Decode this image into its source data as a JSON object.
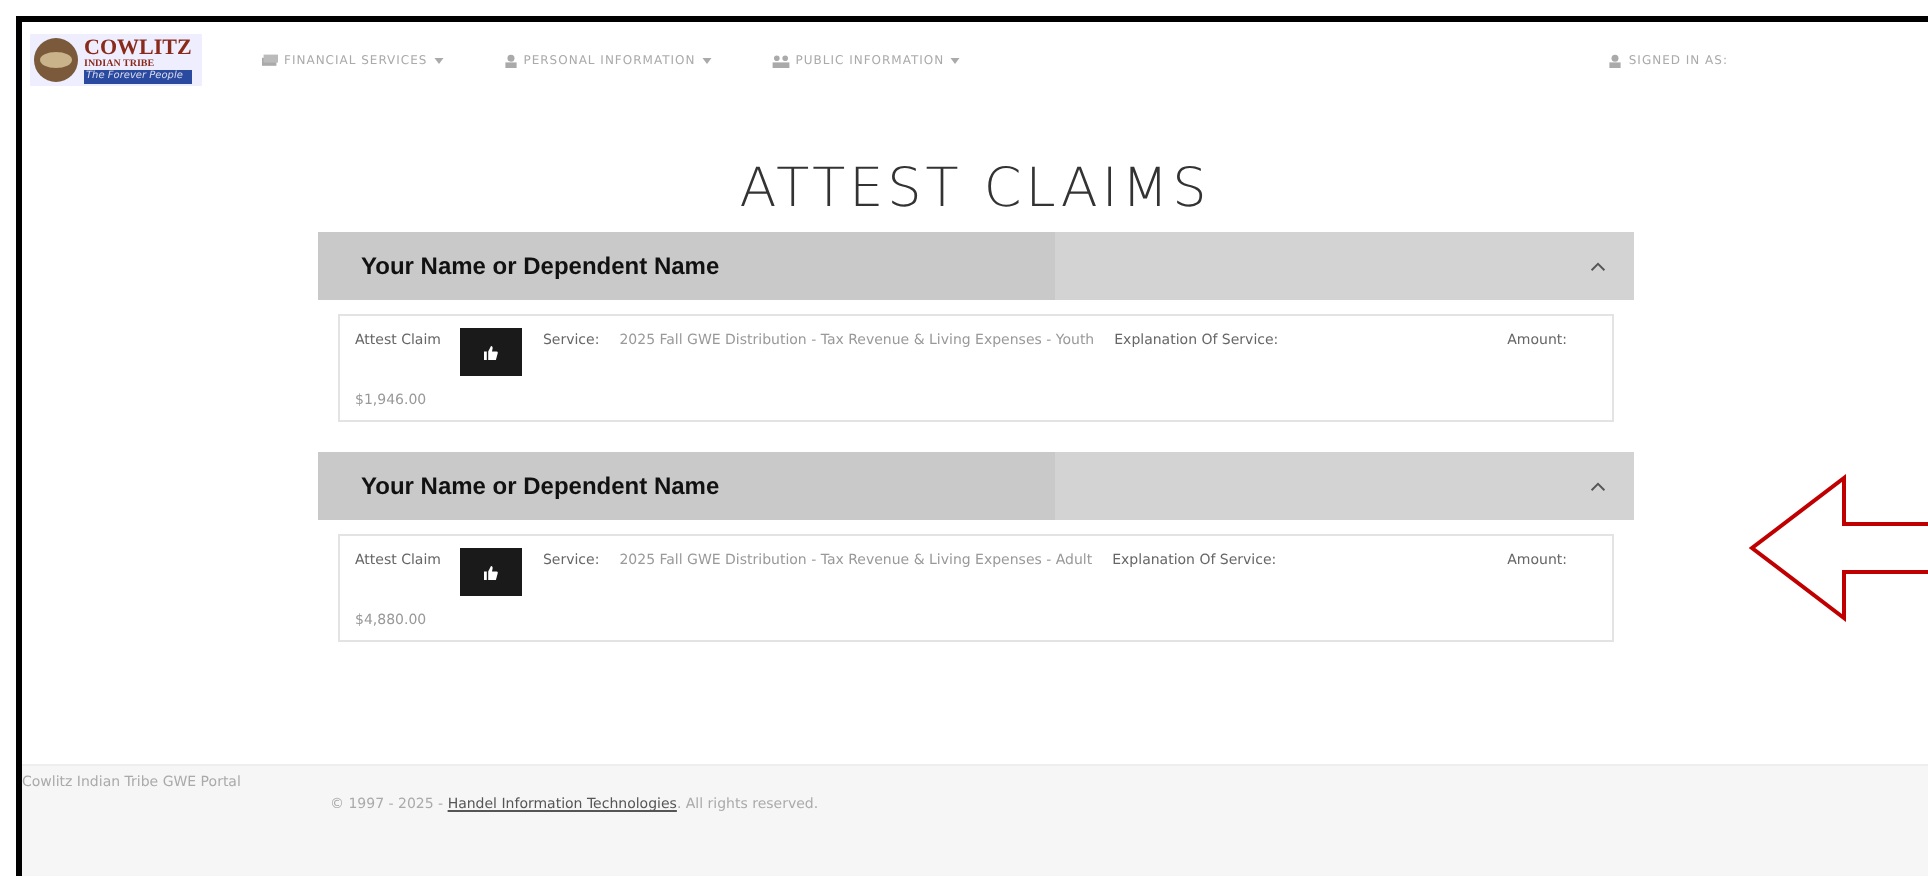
{
  "logo": {
    "title": "COWLITZ",
    "subtitle": "INDIAN TRIBE",
    "tagline": "The Forever People"
  },
  "nav": [
    {
      "label": "FINANCIAL SERVICES",
      "kind": "money"
    },
    {
      "label": "PERSONAL INFORMATION",
      "kind": "user"
    },
    {
      "label": "PUBLIC INFORMATION",
      "kind": "people"
    }
  ],
  "signed_in": "SIGNED IN AS:",
  "page_title": "ATTEST CLAIMS",
  "claims": [
    {
      "name": "Your Name or Dependent Name",
      "expanded": true,
      "attest_label": "Attest Claim",
      "service_label": "Service:",
      "service": "2025 Fall GWE Distribution - Tax Revenue & Living Expenses - Youth",
      "explanation_label": "Explanation Of Service:",
      "amount_label": "Amount:",
      "amount": "$1,946.00"
    },
    {
      "name": "Your Name or Dependent Name",
      "expanded": true,
      "attest_label": "Attest Claim",
      "service_label": "Service:",
      "service": "2025 Fall GWE Distribution - Tax Revenue & Living Expenses - Adult",
      "explanation_label": "Explanation Of Service:",
      "amount_label": "Amount:",
      "amount": "$4,880.00"
    }
  ],
  "footer": {
    "portal": "Cowlitz Indian Tribe GWE Portal",
    "copyright": "© 1997 - 2025 -",
    "company": "Handel Information Technologies",
    "rights": ". All rights reserved."
  }
}
